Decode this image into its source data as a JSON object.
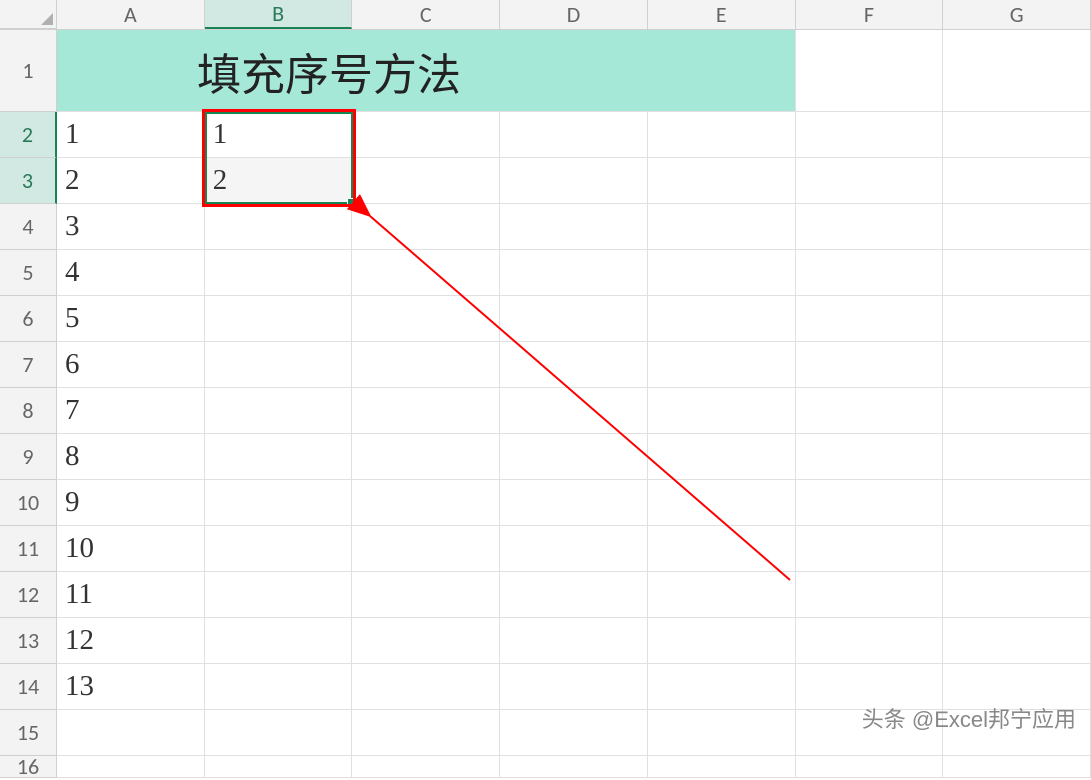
{
  "columns": [
    "A",
    "B",
    "C",
    "D",
    "E",
    "F",
    "G"
  ],
  "active_column": "B",
  "active_rows": [
    "2",
    "3"
  ],
  "title_cell": "填充序号方法",
  "rows": [
    {
      "num": "1",
      "cells": []
    },
    {
      "num": "2",
      "cells": [
        "1",
        "1",
        "",
        "",
        "",
        "",
        ""
      ]
    },
    {
      "num": "3",
      "cells": [
        "2",
        "2",
        "",
        "",
        "",
        "",
        ""
      ]
    },
    {
      "num": "4",
      "cells": [
        "3",
        "",
        "",
        "",
        "",
        "",
        ""
      ]
    },
    {
      "num": "5",
      "cells": [
        "4",
        "",
        "",
        "",
        "",
        "",
        ""
      ]
    },
    {
      "num": "6",
      "cells": [
        "5",
        "",
        "",
        "",
        "",
        "",
        ""
      ]
    },
    {
      "num": "7",
      "cells": [
        "6",
        "",
        "",
        "",
        "",
        "",
        ""
      ]
    },
    {
      "num": "8",
      "cells": [
        "7",
        "",
        "",
        "",
        "",
        "",
        ""
      ]
    },
    {
      "num": "9",
      "cells": [
        "8",
        "",
        "",
        "",
        "",
        "",
        ""
      ]
    },
    {
      "num": "10",
      "cells": [
        "9",
        "",
        "",
        "",
        "",
        "",
        ""
      ]
    },
    {
      "num": "11",
      "cells": [
        "10",
        "",
        "",
        "",
        "",
        "",
        ""
      ]
    },
    {
      "num": "12",
      "cells": [
        "11",
        "",
        "",
        "",
        "",
        "",
        ""
      ]
    },
    {
      "num": "13",
      "cells": [
        "12",
        "",
        "",
        "",
        "",
        "",
        ""
      ]
    },
    {
      "num": "14",
      "cells": [
        "13",
        "",
        "",
        "",
        "",
        "",
        ""
      ]
    },
    {
      "num": "15",
      "cells": [
        "",
        "",
        "",
        "",
        "",
        "",
        ""
      ]
    },
    {
      "num": "16",
      "cells": [
        "",
        "",
        "",
        "",
        "",
        "",
        ""
      ]
    }
  ],
  "watermark": "头条 @Excel邦宁应用",
  "selection_range": "B2:B3",
  "merged_range": "A1:E1"
}
